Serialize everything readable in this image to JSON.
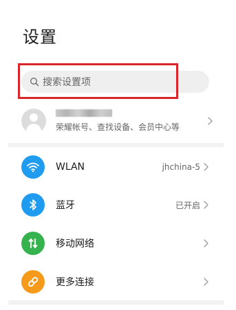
{
  "header": {
    "title": "设置"
  },
  "search": {
    "placeholder": "搜索设置项",
    "icon": "search-icon"
  },
  "highlight": {
    "color": "#d9262b"
  },
  "account": {
    "subtitle": "荣耀帐号、查找设备、会员中心等",
    "avatar_icon": "avatar-icon"
  },
  "items": [
    {
      "label": "WLAN",
      "value": "jhchina-5",
      "icon": "wifi-icon",
      "color": "#1f9bf0"
    },
    {
      "label": "蓝牙",
      "value": "已开启",
      "icon": "bluetooth-icon",
      "color": "#1f9bf0"
    },
    {
      "label": "移动网络",
      "value": "",
      "icon": "mobile-data-icon",
      "color": "#36b34f"
    },
    {
      "label": "更多连接",
      "value": "",
      "icon": "link-icon",
      "color": "#f59a1b"
    }
  ]
}
